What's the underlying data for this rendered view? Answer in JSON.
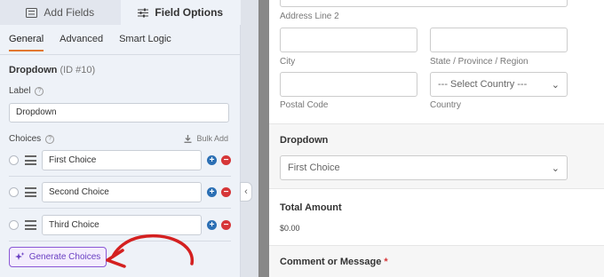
{
  "panel_tabs": {
    "add_fields": "Add Fields",
    "field_options": "Field Options"
  },
  "subtabs": [
    "General",
    "Advanced",
    "Smart Logic"
  ],
  "field": {
    "name": "Dropdown",
    "id": "(ID #10)"
  },
  "label": {
    "caption": "Label",
    "value": "Dropdown"
  },
  "choices": {
    "caption": "Choices",
    "bulk_add": "Bulk Add",
    "items": [
      "First Choice",
      "Second Choice",
      "Third Choice"
    ]
  },
  "generate_button": "Generate Choices",
  "preview": {
    "address_line2": "Address Line 2",
    "city": "City",
    "state": "State / Province / Region",
    "postal_code": "Postal Code",
    "country": "Country",
    "country_placeholder": "--- Select Country ---",
    "dropdown_title": "Dropdown",
    "dropdown_value": "First Choice",
    "total_title": "Total Amount",
    "total_value": "$0.00",
    "comment_title": "Comment or Message",
    "required_mark": "*"
  },
  "colors": {
    "accent_tab": "#e27730",
    "add_blue": "#2b6fb4",
    "delete_red": "#d63638",
    "ai_purple": "#6a3fc2",
    "annotation_arrow": "#d42020"
  }
}
